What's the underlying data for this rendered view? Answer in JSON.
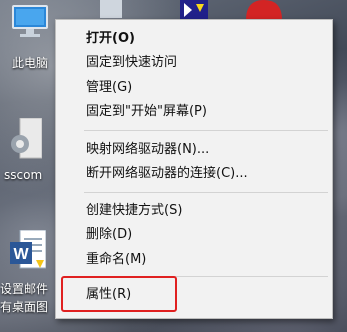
{
  "desktop": {
    "icons": [
      {
        "name": "this-pc",
        "label": "此电脑"
      },
      {
        "name": "sscom",
        "label": "sscom"
      },
      {
        "name": "word-doc",
        "label_line1": "设置邮件",
        "label_line2": "有桌面图"
      }
    ]
  },
  "context_menu": {
    "items": [
      {
        "label": "打开(O)"
      },
      {
        "label": "固定到快速访问"
      },
      {
        "label": "管理(G)"
      },
      {
        "label": "固定到\"开始\"屏幕(P)"
      },
      {
        "label": "映射网络驱动器(N)..."
      },
      {
        "label": "断开网络驱动器的连接(C)..."
      },
      {
        "label": "创建快捷方式(S)"
      },
      {
        "label": "删除(D)"
      },
      {
        "label": "重命名(M)"
      },
      {
        "label": "属性(R)"
      }
    ]
  },
  "colors": {
    "menu_bg": "#f2f2f2",
    "highlight_border": "#e02020"
  }
}
